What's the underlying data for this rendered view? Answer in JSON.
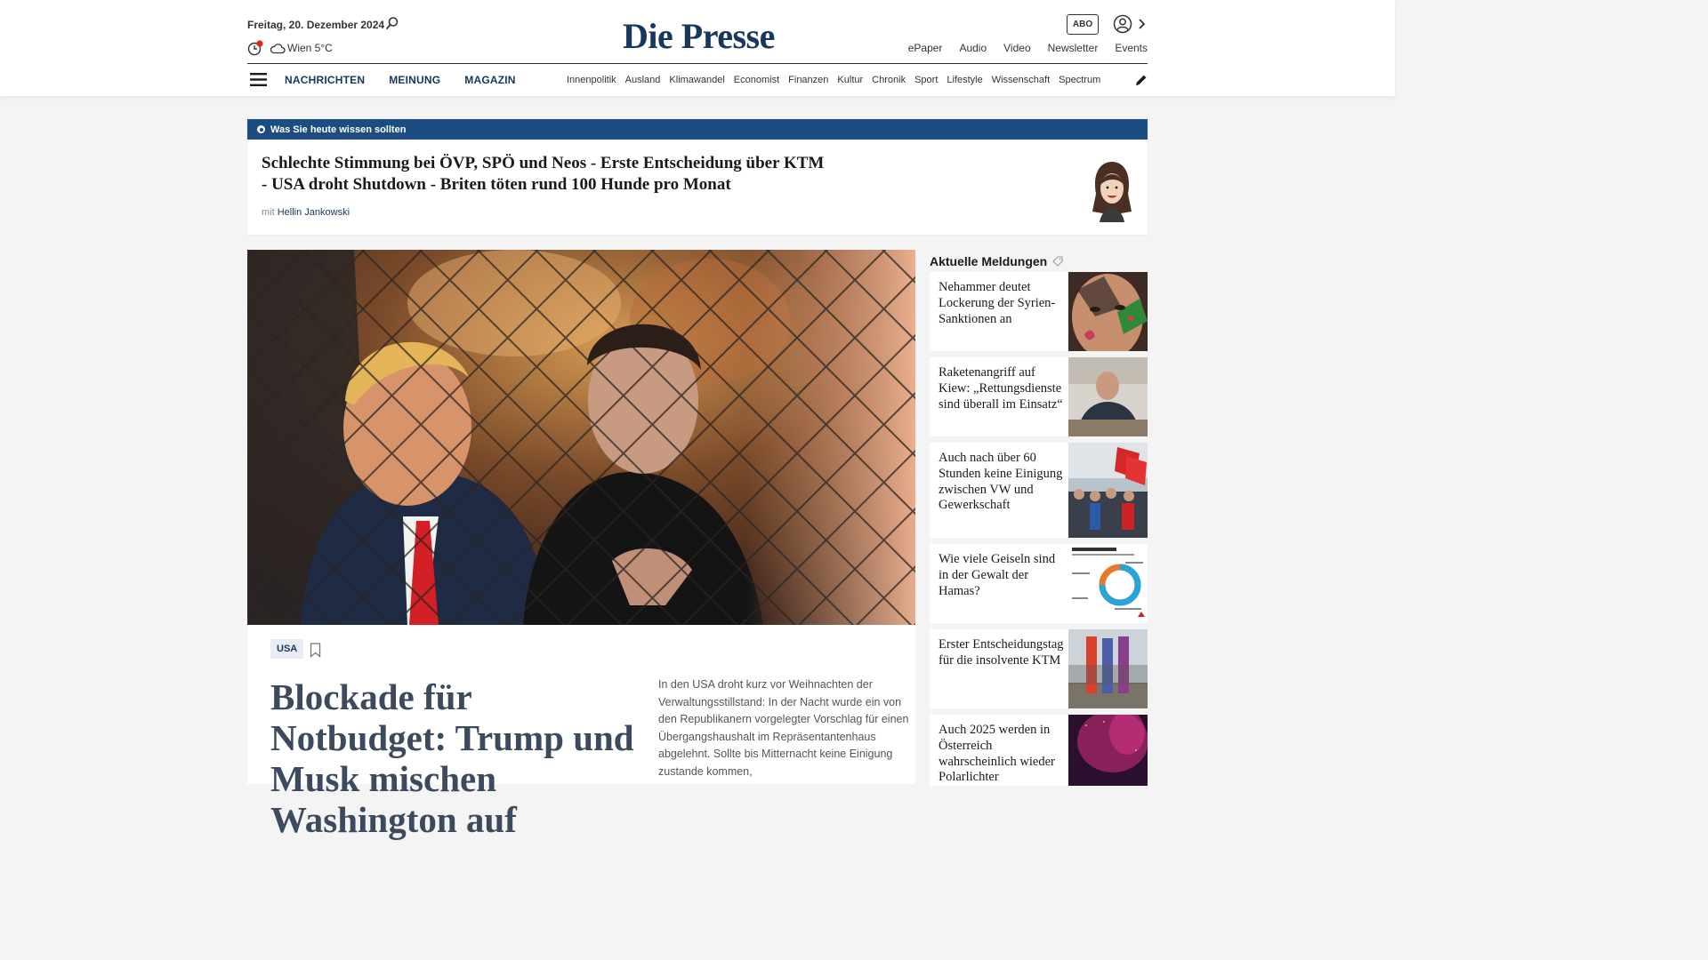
{
  "header": {
    "date": "Freitag, 20. Dezember 2024",
    "weather": "Wien 5°C",
    "logo": "Die Presse",
    "abo_label": "ABO",
    "top_links": [
      "ePaper",
      "Audio",
      "Video",
      "Newsletter",
      "Events"
    ],
    "main_nav": [
      "NACHRICHTEN",
      "MEINUNG",
      "MAGAZIN"
    ],
    "sub_nav": [
      "Innenpolitik",
      "Ausland",
      "Klimawandel",
      "Economist",
      "Finanzen",
      "Kultur",
      "Chronik",
      "Sport",
      "Lifestyle",
      "Wissenschaft",
      "Spectrum"
    ]
  },
  "briefing": {
    "label": "Was Sie heute wissen sollten",
    "title": "Schlechte Stimmung bei ÖVP, SPÖ und Neos - Erste Entscheidung über KTM - USA droht Shutdown - Briten töten rund 100 Hunde pro Monat",
    "author_prefix": "mit",
    "author": "Hellin Jankowski"
  },
  "hero": {
    "tag": "USA",
    "title": "Blockade für Notbudget: Trump und Musk mischen Washington auf",
    "teaser": "In den USA droht kurz vor Weihnachten der Verwaltungsstillstand: In der Nacht wurde ein von den Republikanern vorgelegter Vorschlag für einen Übergangshaushalt im Repräsentantenhaus abgelehnt. Sollte bis Mitternacht keine Einigung zustande kommen,"
  },
  "aside": {
    "heading": "Aktuelle Meldungen",
    "items": [
      {
        "title": "Nehammer deutet Lockerung der Sy­rien-Sanktionen an"
      },
      {
        "title": "Raketenangriff auf Kiew: „Ret­tungsdienste sind überall im Einsatz“"
      },
      {
        "title": "Auch nach über 60 Stunden keine Einigung zwischen VW und Gewerkschaft"
      },
      {
        "title": "Wie viele Geiseln sind in der Gewalt der Hamas?"
      },
      {
        "title": "Erster Entschei­dungstag für die insolvente KTM"
      },
      {
        "title": "Auch 2025 werden in Österreich wahrscheinlich wieder Polarlichter"
      }
    ]
  },
  "colors": {
    "brand": "#17375e",
    "briefing_bar": "#1c4c80",
    "background": "#f4f4f4"
  }
}
